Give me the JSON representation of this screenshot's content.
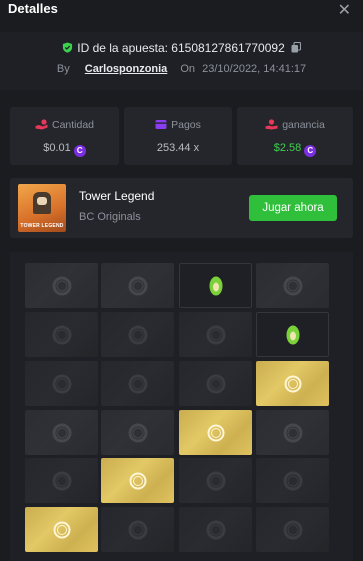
{
  "header": {
    "title": "Detalles",
    "close_glyph": "✕"
  },
  "bet": {
    "id_label": "ID de la apuesta: 61508127861770092",
    "by_label": "By",
    "user": "Carlosponzonia",
    "on_label": "On",
    "date": "23/10/2022, 14:41:17"
  },
  "stats": {
    "amount": {
      "label": "Cantidad",
      "value": "$0.01",
      "icon": "hand-coins-icon"
    },
    "payout": {
      "label": "Pagos",
      "value": "253.44 x",
      "icon": "wallet-icon"
    },
    "profit": {
      "label": "ganancia",
      "value": "$2.58",
      "icon": "profit-icon"
    },
    "coin_glyph": "C"
  },
  "game": {
    "name": "Tower Legend",
    "provider": "BC Originals",
    "play_label": "Jugar ahora",
    "thumb_text": "TOWER LEGEND"
  },
  "colors": {
    "accent_green": "#2fbf3a",
    "gold_tile": "#e3c866",
    "coin_purple": "#7b2fe0"
  },
  "board": {
    "rows": [
      [
        "hidden",
        "hidden",
        "egg",
        "hidden"
      ],
      [
        "hidden-dim",
        "hidden-dim",
        "hidden-dim",
        "egg"
      ],
      [
        "hidden-dim",
        "hidden-dim",
        "hidden-dim",
        "gold"
      ],
      [
        "hidden",
        "hidden",
        "gold",
        "hidden"
      ],
      [
        "hidden-dim",
        "gold",
        "hidden-dim",
        "hidden-dim"
      ],
      [
        "gold",
        "hidden-dim",
        "hidden-dim",
        "hidden-dim"
      ]
    ]
  }
}
